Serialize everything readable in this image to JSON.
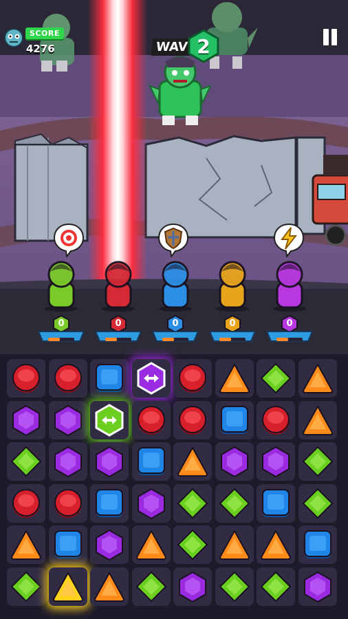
{
  "hud": {
    "score_label": "SCORE",
    "score_value": "4276",
    "wave_label": "WAVE",
    "wave_number": "2"
  },
  "heroes": [
    {
      "name": "green-hero",
      "count": "0",
      "bubble_icon": "target-icon",
      "color": "#7acb2a",
      "charge": 0.45
    },
    {
      "name": "red-hero",
      "count": "0",
      "bubble_icon": null,
      "color": "#d32a36",
      "charge": 0.45
    },
    {
      "name": "blue-hero",
      "count": "0",
      "bubble_icon": "shield-icon",
      "color": "#2c8fe6",
      "charge": 0.45
    },
    {
      "name": "yellow-hero",
      "count": "0",
      "bubble_icon": null,
      "color": "#e8a51c",
      "charge": 0.45
    },
    {
      "name": "purple-hero",
      "count": "0",
      "bubble_icon": "lightning-icon",
      "color": "#b838e0",
      "charge": 0.45
    }
  ],
  "colors": {
    "red": "#d8202c",
    "blue": "#1f86e8",
    "purple": "#9b2be0",
    "green": "#6bcf1f",
    "orange": "#ff8c1a",
    "yellow": "#ffd21e",
    "laser": "#ff2d3f"
  },
  "board": {
    "rows": [
      [
        "red",
        "red",
        "blue",
        "purple-swap-power",
        "red",
        "orange",
        "green",
        "orange"
      ],
      [
        "purple",
        "purple",
        "green-swap-power",
        "red",
        "red",
        "blue",
        "red",
        "orange"
      ],
      [
        "green",
        "purple",
        "purple",
        "blue",
        "orange",
        "purple",
        "purple",
        "green"
      ],
      [
        "red",
        "red",
        "blue",
        "purple",
        "green",
        "green",
        "blue",
        "green"
      ],
      [
        "orange",
        "blue",
        "purple",
        "orange",
        "green",
        "orange",
        "orange",
        "blue"
      ],
      [
        "green",
        "yellow-selected",
        "orange",
        "green",
        "purple",
        "green",
        "green",
        "purple"
      ]
    ]
  }
}
